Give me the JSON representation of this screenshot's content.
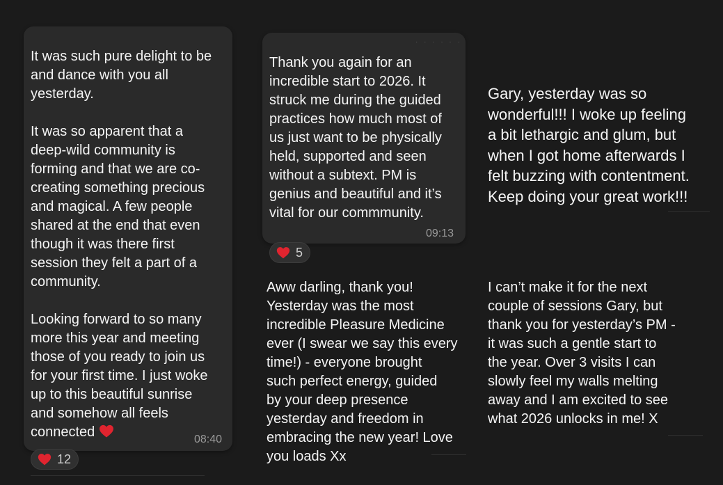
{
  "messages": [
    {
      "text": "It was such pure delight to be\nand dance with you all\nyesterday.\n\nIt was so apparent that a\ndeep-wild community is\nforming and that we are co-\ncreating something precious\nand magical. A few people\nshared at the end that even\nthough it was there first\nsession they felt a part of a\ncommunity.\n\nLooking forward to so many\nmore this year and meeting\nthose of you ready to join us\nfor your first time. I just woke\nup to this beautiful sunrise\nand somehow all feels\nconnected",
      "time": "08:40",
      "reaction_count": "12"
    },
    {
      "text": "Thank you again for an\nincredible start to 2026. It\nstruck me during the guided\npractices how much most of\nus just want to be physically\nheld, supported and seen\nwithout a subtext. PM is\ngenius and beautiful and it’s\nvital for our commmunity.",
      "time": "09:13",
      "reaction_count": "5"
    },
    {
      "text": "Gary, yesterday was so\nwonderful!!! I woke up feeling\na bit lethargic and glum, but\nwhen I got home afterwards I\nfelt buzzing with contentment.\nKeep doing your great work!!!"
    },
    {
      "text": "Aww darling, thank you!\nYesterday was the most\nincredible Pleasure Medicine\never (I swear we say this every\ntime!) - everyone brought\nsuch perfect energy, guided\nby your deep presence\nyesterday and freedom in\nembracing the new year! Love\nyou loads Xx"
    },
    {
      "text": "I can’t make it for the next\ncouple of sessions Gary, but\nthank you for yesterday’s PM -\nit was such a gentle start to\nthe year. Over 3 visits I can\nslowly feel my walls melting\naway and I am excited to see\nwhat 2026 unlocks in me! X"
    }
  ],
  "colors": {
    "background": "#1b1b1b",
    "bubble": "#2a2a2a",
    "heart": "#e0242f"
  },
  "icons": {
    "reaction": "red-heart-icon"
  }
}
